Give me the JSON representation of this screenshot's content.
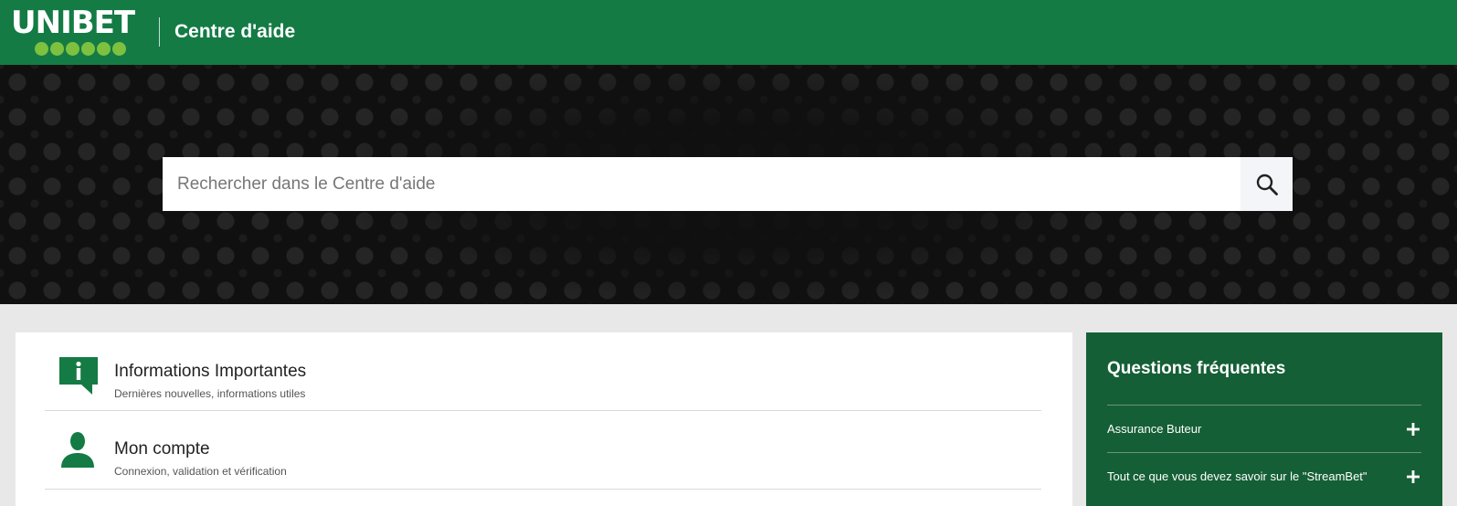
{
  "header": {
    "logo_text": "UNIBET",
    "title": "Centre d'aide",
    "bg_color": "#147b45",
    "dot_color": "#7dc13f"
  },
  "search": {
    "placeholder": "Rechercher dans le Centre d'aide",
    "value": "",
    "button_icon": "search-icon"
  },
  "categories": [
    {
      "icon": "info-bubble-icon",
      "title": "Informations Importantes",
      "description": "Dernières nouvelles, informations utiles"
    },
    {
      "icon": "user-icon",
      "title": "Mon compte",
      "description": "Connexion, validation et vérification"
    }
  ],
  "faq": {
    "title": "Questions fréquentes",
    "bg_color": "#155f36",
    "items": [
      {
        "label": "Assurance Buteur",
        "icon": "plus-icon"
      },
      {
        "label": "Tout ce que vous devez savoir sur le \"StreamBet\"",
        "icon": "plus-icon"
      }
    ]
  }
}
